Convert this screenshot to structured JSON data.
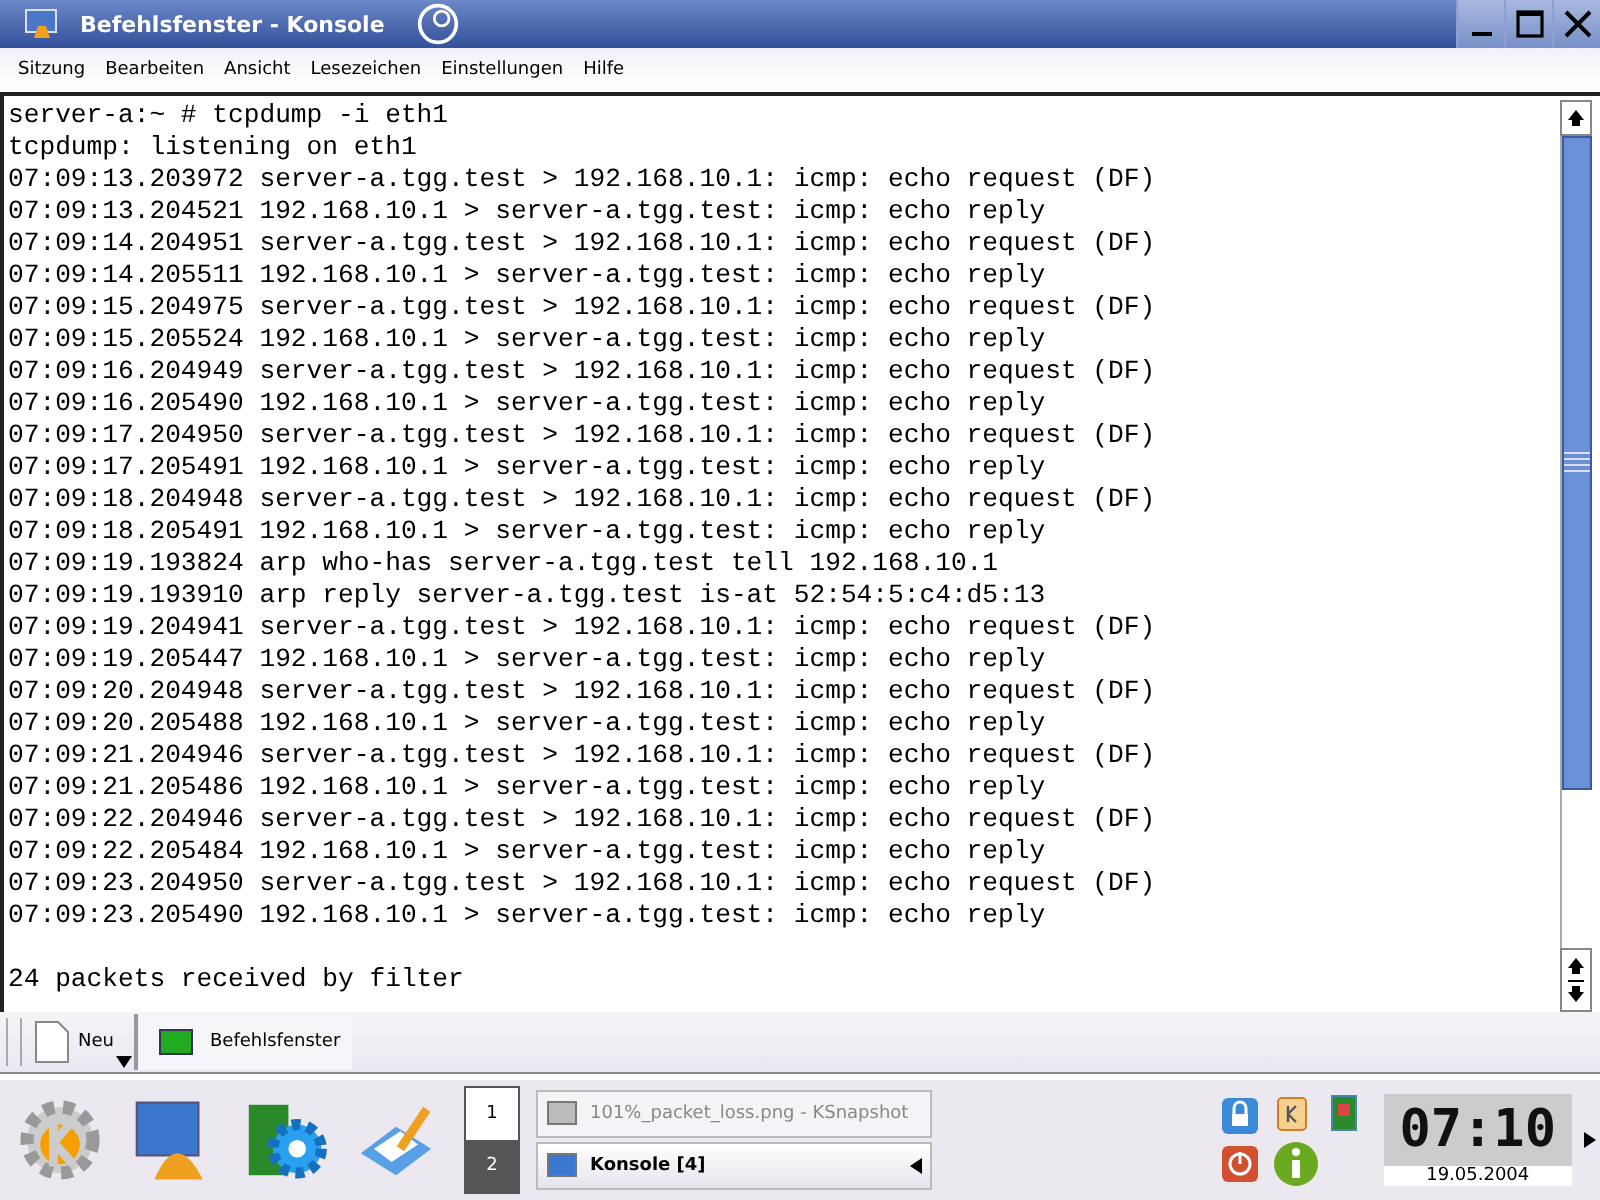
{
  "window": {
    "title": "Befehlsfenster - Konsole"
  },
  "menu": [
    "Sitzung",
    "Bearbeiten",
    "Ansicht",
    "Lesezeichen",
    "Einstellungen",
    "Hilfe"
  ],
  "terminal": {
    "lines": [
      "server-a:~ # tcpdump -i eth1",
      "tcpdump: listening on eth1",
      "07:09:13.203972 server-a.tgg.test > 192.168.10.1: icmp: echo request (DF)",
      "07:09:13.204521 192.168.10.1 > server-a.tgg.test: icmp: echo reply",
      "07:09:14.204951 server-a.tgg.test > 192.168.10.1: icmp: echo request (DF)",
      "07:09:14.205511 192.168.10.1 > server-a.tgg.test: icmp: echo reply",
      "07:09:15.204975 server-a.tgg.test > 192.168.10.1: icmp: echo request (DF)",
      "07:09:15.205524 192.168.10.1 > server-a.tgg.test: icmp: echo reply",
      "07:09:16.204949 server-a.tgg.test > 192.168.10.1: icmp: echo request (DF)",
      "07:09:16.205490 192.168.10.1 > server-a.tgg.test: icmp: echo reply",
      "07:09:17.204950 server-a.tgg.test > 192.168.10.1: icmp: echo request (DF)",
      "07:09:17.205491 192.168.10.1 > server-a.tgg.test: icmp: echo reply",
      "07:09:18.204948 server-a.tgg.test > 192.168.10.1: icmp: echo request (DF)",
      "07:09:18.205491 192.168.10.1 > server-a.tgg.test: icmp: echo reply",
      "07:09:19.193824 arp who-has server-a.tgg.test tell 192.168.10.1",
      "07:09:19.193910 arp reply server-a.tgg.test is-at 52:54:5:c4:d5:13",
      "07:09:19.204941 server-a.tgg.test > 192.168.10.1: icmp: echo request (DF)",
      "07:09:19.205447 192.168.10.1 > server-a.tgg.test: icmp: echo reply",
      "07:09:20.204948 server-a.tgg.test > 192.168.10.1: icmp: echo request (DF)",
      "07:09:20.205488 192.168.10.1 > server-a.tgg.test: icmp: echo reply",
      "07:09:21.204946 server-a.tgg.test > 192.168.10.1: icmp: echo request (DF)",
      "07:09:21.205486 192.168.10.1 > server-a.tgg.test: icmp: echo reply",
      "07:09:22.204946 server-a.tgg.test > 192.168.10.1: icmp: echo request (DF)",
      "07:09:22.205484 192.168.10.1 > server-a.tgg.test: icmp: echo reply",
      "07:09:23.204950 server-a.tgg.test > 192.168.10.1: icmp: echo request (DF)",
      "07:09:23.205490 192.168.10.1 > server-a.tgg.test: icmp: echo reply"
    ],
    "summary": "24 packets received by filter"
  },
  "session_bar": {
    "new_button": "Neu",
    "tabs": [
      {
        "label": "Befehlsfenster",
        "selected": true
      }
    ]
  },
  "taskbar": {
    "desktops": [
      {
        "label": "1",
        "selected": false
      },
      {
        "label": "2",
        "selected": true
      }
    ],
    "tasks": [
      {
        "label": "101%_packet_loss.png - KSnapshot",
        "selected": false
      },
      {
        "label": "Konsole [4]",
        "selected": true
      }
    ],
    "clock": "07:10",
    "date": "19.05.2004"
  }
}
